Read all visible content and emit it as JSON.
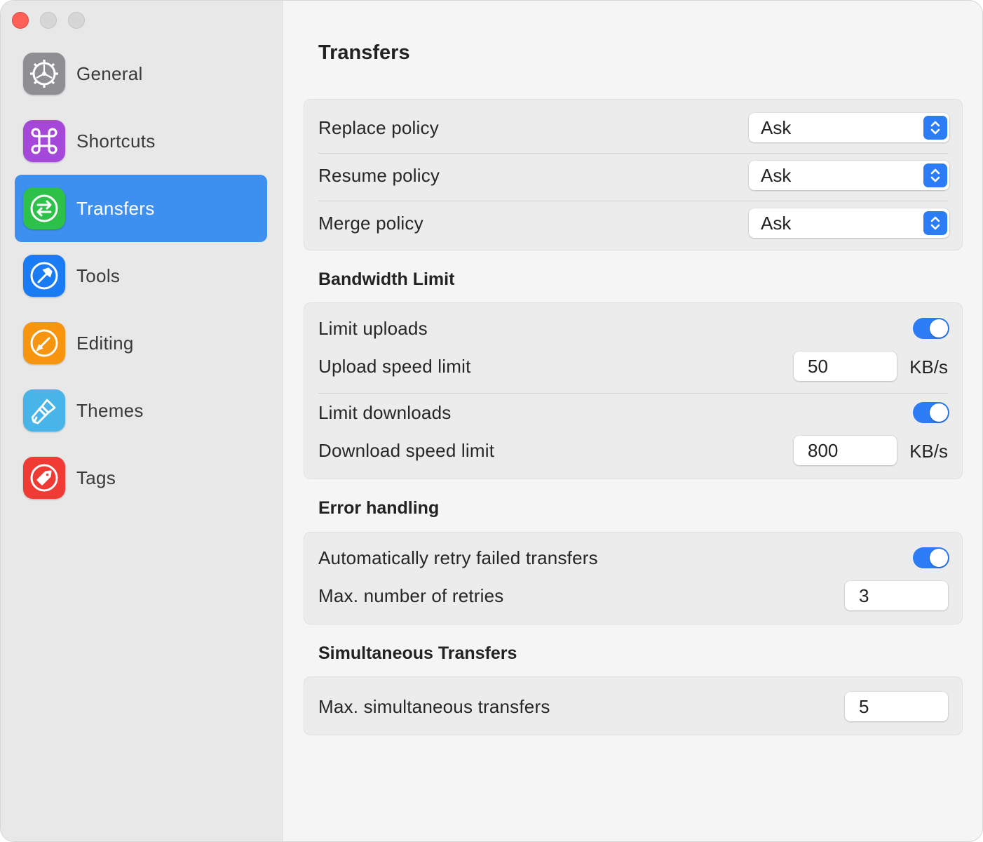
{
  "sidebar": {
    "items": [
      {
        "label": "General",
        "icon": "gear-icon",
        "color": "#8e8e93"
      },
      {
        "label": "Shortcuts",
        "icon": "command-icon",
        "color": "#a547d9"
      },
      {
        "label": "Transfers",
        "icon": "transfer-arrows-icon",
        "color": "#2dc14a",
        "active": true
      },
      {
        "label": "Tools",
        "icon": "hammer-icon",
        "color": "#1a7cf5"
      },
      {
        "label": "Editing",
        "icon": "pencil-icon",
        "color": "#f7950f"
      },
      {
        "label": "Themes",
        "icon": "paintbrush-icon",
        "color": "#49b4e8"
      },
      {
        "label": "Tags",
        "icon": "tag-icon",
        "color": "#f03b35"
      }
    ]
  },
  "main": {
    "title": "Transfers",
    "policies": [
      {
        "label": "Replace policy",
        "value": "Ask"
      },
      {
        "label": "Resume policy",
        "value": "Ask"
      },
      {
        "label": "Merge policy",
        "value": "Ask"
      }
    ],
    "bandwidth": {
      "title": "Bandwidth Limit",
      "limit_uploads_label": "Limit uploads",
      "limit_uploads_on": true,
      "upload_speed_label": "Upload speed limit",
      "upload_speed_value": "50",
      "upload_unit": "KB/s",
      "limit_downloads_label": "Limit downloads",
      "limit_downloads_on": true,
      "download_speed_label": "Download speed limit",
      "download_speed_value": "800",
      "download_unit": "KB/s"
    },
    "errors": {
      "title": "Error handling",
      "retry_label": "Automatically retry failed transfers",
      "retry_on": true,
      "max_retries_label": "Max. number of retries",
      "max_retries_value": "3"
    },
    "simultaneous": {
      "title": "Simultaneous Transfers",
      "max_label": "Max. simultaneous transfers",
      "max_value": "5"
    }
  }
}
